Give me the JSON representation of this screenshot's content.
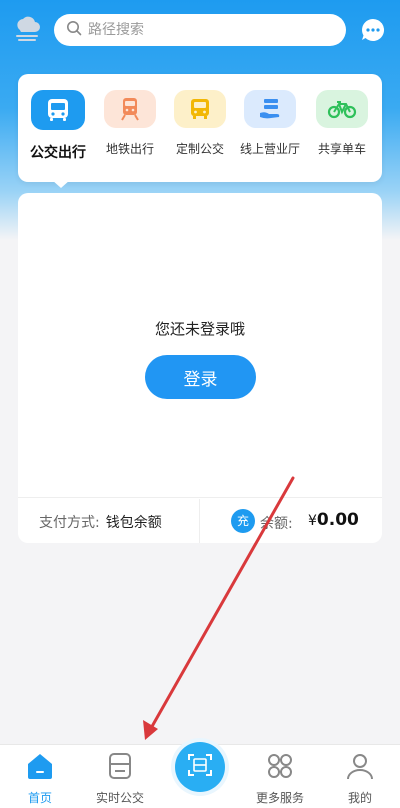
{
  "search": {
    "placeholder": "路径搜索"
  },
  "categories": [
    {
      "label": "公交出行",
      "icon": "bus-icon",
      "color": "#1e9bf0",
      "bg": "#1e9bf0"
    },
    {
      "label": "地铁出行",
      "icon": "subway-icon",
      "color": "#f28a5a",
      "bg": "#fde5d8"
    },
    {
      "label": "定制公交",
      "icon": "custom-bus-icon",
      "color": "#f2b705",
      "bg": "#fdf0c9"
    },
    {
      "label": "线上营业厅",
      "icon": "online-hall-icon",
      "color": "#3a8ff0",
      "bg": "#dbeafd"
    },
    {
      "label": "共享单车",
      "icon": "bike-icon",
      "color": "#2ec05a",
      "bg": "#d9f4df"
    }
  ],
  "card": {
    "notice": "您还未登录哦",
    "login_label": "登录",
    "pay_label": "支付方式:",
    "pay_value": "钱包余额",
    "recharge_label": "充",
    "balance_label": "余额:",
    "currency": "¥",
    "balance_value": "0.00"
  },
  "tabbar": {
    "items": [
      {
        "label": "首页",
        "icon": "home-icon",
        "active": true
      },
      {
        "label": "实时公交",
        "icon": "realtime-bus-icon",
        "active": false
      },
      {
        "label": "",
        "icon": "scan-icon",
        "active": false
      },
      {
        "label": "更多服务",
        "icon": "more-services-icon",
        "active": false
      },
      {
        "label": "我的",
        "icon": "profile-icon",
        "active": false
      }
    ]
  },
  "colors": {
    "accent": "#1e9bf0",
    "annotation_arrow": "#d9393c"
  }
}
